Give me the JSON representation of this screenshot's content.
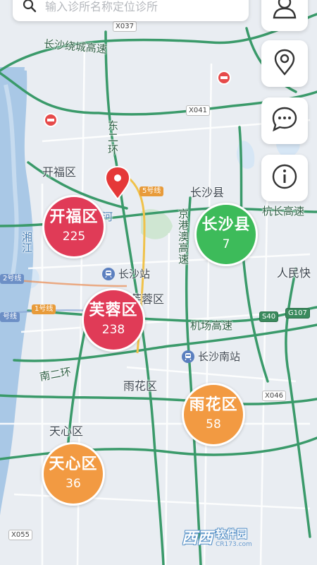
{
  "search": {
    "placeholder": "输入诊所名称定位诊所",
    "icon": "search-icon"
  },
  "side_buttons": [
    {
      "icon": "user-icon"
    },
    {
      "icon": "location-pin-icon"
    },
    {
      "icon": "chat-icon"
    },
    {
      "icon": "info-icon"
    }
  ],
  "clusters": [
    {
      "name": "开福区",
      "count": "225",
      "color": "#e03b57"
    },
    {
      "name": "长沙县",
      "count": "7",
      "color": "#3dbb5a"
    },
    {
      "name": "芙蓉区",
      "count": "238",
      "color": "#e03b57"
    },
    {
      "name": "雨花区",
      "count": "58",
      "color": "#f29a42"
    },
    {
      "name": "天心区",
      "count": "36",
      "color": "#f29a42"
    }
  ],
  "map_labels": {
    "kaifu": "开福区",
    "changsha_county": "长沙县",
    "furong": "芙蓉区",
    "yuhua": "雨花区",
    "tianxin": "天心区",
    "changsha_station": "长沙站",
    "changsha_south_station": "长沙南站",
    "renmin": "人民快",
    "raocheng": "长沙绕城高速",
    "dongerhuan": "东二环",
    "jingzhuao": "京港澳高速",
    "hangchang": "杭长高速",
    "jichang": "机场高速",
    "nanerhuan": "南二环",
    "xiangjiang": "湘江",
    "he": "河"
  },
  "shields": {
    "x037": "X037",
    "x041": "X041",
    "x046": "X046",
    "x055": "X055",
    "s40": "S40",
    "g107": "G107"
  },
  "metro_lines": {
    "line1": "1号线",
    "line2": "2号线",
    "line5": "5号线",
    "line_partial": "号线"
  },
  "watermark": {
    "logo": "西西",
    "name": "软件园",
    "url": "CR173.com"
  },
  "colors": {
    "highway": "#3a9a6a",
    "river": "#a9c8e6",
    "land": "#e9edf2",
    "marker": "#e53838"
  }
}
